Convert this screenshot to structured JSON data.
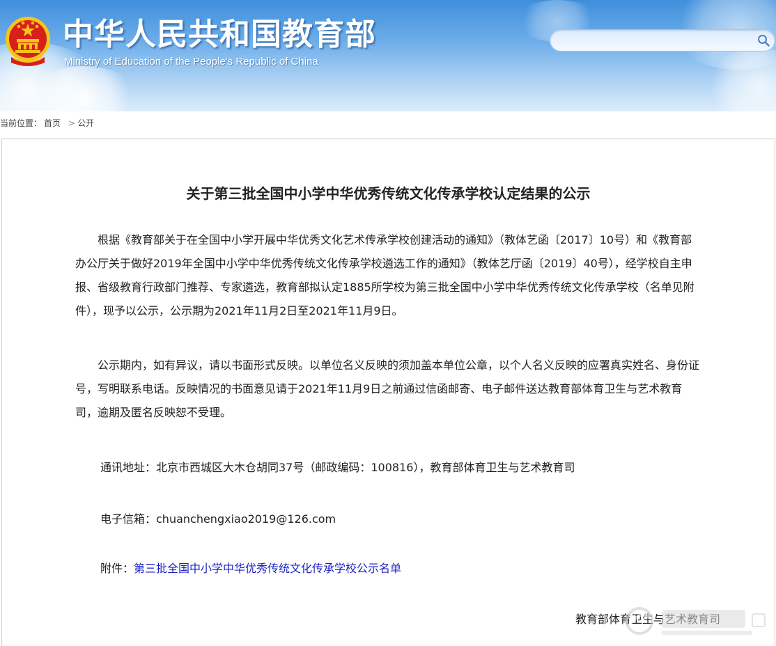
{
  "header": {
    "site_title": "中华人民共和国教育部",
    "site_subtitle": "Ministry of Education of the People's Republic of China",
    "search": {
      "value": "",
      "placeholder": ""
    }
  },
  "breadcrumb": {
    "label": "当前位置：",
    "items": [
      "首页",
      "公开"
    ],
    "separator": ">"
  },
  "article": {
    "title": "关于第三批全国中小学中华优秀传统文化传承学校认定结果的公示",
    "paragraph1": "根据《教育部关于在全国中小学开展中华优秀文化艺术传承学校创建活动的通知》（教体艺函〔2017〕10号）和《教育部办公厅关于做好2019年全国中小学中华优秀传统文化传承学校遴选工作的通知》（教体艺厅函〔2019〕40号），经学校自主申报、省级教育行政部门推荐、专家遴选，教育部拟认定1885所学校为第三批全国中小学中华优秀传统文化传承学校（名单见附件），现予以公示，公示期为2021年11月2日至2021年11月9日。",
    "paragraph2": "公示期内，如有异议，请以书面形式反映。以单位名义反映的须加盖本单位公章，以个人名义反映的应署真实姓名、身份证号，写明联系电话。反映情况的书面意见请于2021年11月9日之前通过信函邮寄、电子邮件送达教育部体育卫生与艺术教育司，逾期及匿名反映恕不受理。",
    "address": "通讯地址：北京市西城区大木仓胡同37号（邮政编码：100816），教育部体育卫生与艺术教育司",
    "email": "电子信箱：chuanchengxiao2019@126.com",
    "attachment_label": "附件：",
    "attachment_link": "第三批全国中小学中华优秀传统文化传承学校公示名单",
    "signature": "教育部体育卫生与艺术教育司"
  },
  "colors": {
    "header_top": "#3f8fdc",
    "header_bottom": "#dcecfa",
    "link": "#1a24c4",
    "emblem_red": "#d7201a",
    "emblem_gold": "#f5c518"
  },
  "icons": {
    "search": "magnifier-icon",
    "emblem": "national-emblem-icon",
    "watermark": "site-watermark-logo"
  }
}
